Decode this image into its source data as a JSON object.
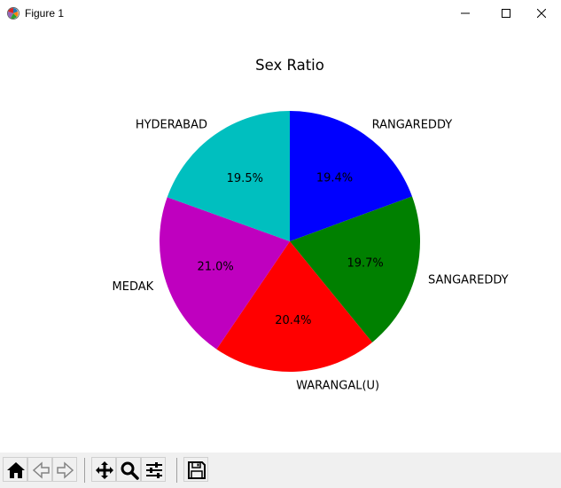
{
  "window": {
    "title": "Figure 1",
    "icon": "matplotlib-icon",
    "controls": [
      "minimize-icon",
      "maximize-icon",
      "close-icon"
    ]
  },
  "chart_data": {
    "type": "pie",
    "title": "Sex Ratio",
    "labels": [
      "RANGAREDDY",
      "SANGAREDDY",
      "WARANGAL(U)",
      "MEDAK",
      "HYDERABAD"
    ],
    "values": [
      19.4,
      19.7,
      20.4,
      21.0,
      19.5
    ],
    "autopct_labels": [
      "19.4%",
      "19.7%",
      "20.4%",
      "21.0%",
      "19.5%"
    ],
    "colors": [
      "#0000ff",
      "#008000",
      "#ff0000",
      "#bf00bf",
      "#00bfbf"
    ],
    "startangle": 90,
    "counterclock": false
  },
  "toolbar": {
    "buttons": [
      {
        "name": "home-button",
        "icon": "home-icon"
      },
      {
        "name": "back-button",
        "icon": "back-arrow-icon"
      },
      {
        "name": "forward-button",
        "icon": "forward-arrow-icon"
      },
      {
        "name": "pan-button",
        "icon": "move-icon"
      },
      {
        "name": "zoom-button",
        "icon": "magnifier-icon"
      },
      {
        "name": "configure-subplots-button",
        "icon": "sliders-icon"
      },
      {
        "name": "save-button",
        "icon": "floppy-disk-icon"
      }
    ]
  }
}
